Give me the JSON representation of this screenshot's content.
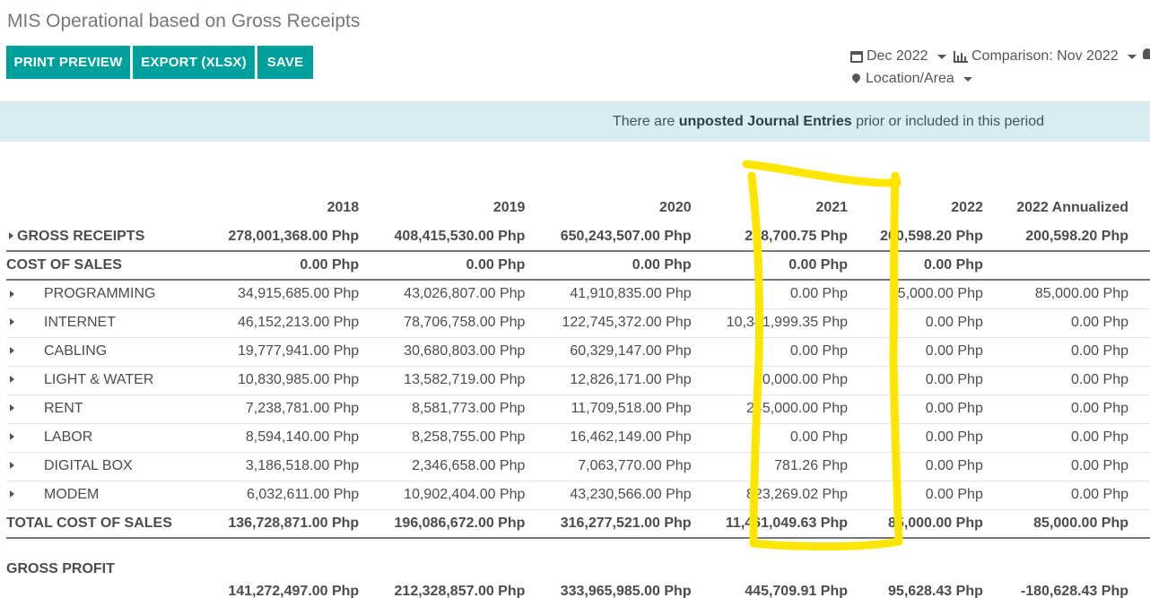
{
  "page": {
    "title": "MIS Operational based on Gross Receipts"
  },
  "toolbar": {
    "print_label": "PRINT PREVIEW",
    "export_label": "EXPORT (XLSX)",
    "save_label": "SAVE"
  },
  "filters": {
    "date": "Dec 2022",
    "comparison": "Comparison: Nov 2022",
    "location": "Location/Area"
  },
  "notice": {
    "prefix": "There are ",
    "bold": "unposted Journal Entries",
    "suffix": " prior or included in this period"
  },
  "table": {
    "columns": [
      "2018",
      "2019",
      "2020",
      "2021",
      "2022",
      "2022 Annualized"
    ],
    "gross_receipts": {
      "label": "GROSS RECEIPTS",
      "values": [
        "278,001,368.00 Php",
        "408,415,530.00 Php",
        "650,243,507.00 Php",
        "298,700.75 Php",
        "200,598.20 Php",
        "200,598.20 Php"
      ]
    },
    "cost_of_sales": {
      "label": "COST OF SALES",
      "values": [
        "0.00 Php",
        "0.00 Php",
        "0.00 Php",
        "0.00 Php",
        "0.00 Php",
        ""
      ]
    },
    "items": [
      {
        "label": "PROGRAMMING",
        "values": [
          "34,915,685.00 Php",
          "43,026,807.00 Php",
          "41,910,835.00 Php",
          "0.00 Php",
          "85,000.00 Php",
          "85,000.00 Php"
        ]
      },
      {
        "label": "INTERNET",
        "values": [
          "46,152,213.00 Php",
          "78,706,758.00 Php",
          "122,745,372.00 Php",
          "10,341,999.35 Php",
          "0.00 Php",
          "0.00 Php"
        ]
      },
      {
        "label": "CABLING",
        "values": [
          "19,777,941.00 Php",
          "30,680,803.00 Php",
          "60,329,147.00 Php",
          "0.00 Php",
          "0.00 Php",
          "0.00 Php"
        ]
      },
      {
        "label": "LIGHT & WATER",
        "values": [
          "10,830,985.00 Php",
          "13,582,719.00 Php",
          "12,826,171.00 Php",
          "50,000.00 Php",
          "0.00 Php",
          "0.00 Php"
        ]
      },
      {
        "label": "RENT",
        "values": [
          "7,238,781.00 Php",
          "8,581,773.00 Php",
          "11,709,518.00 Php",
          "245,000.00 Php",
          "0.00 Php",
          "0.00 Php"
        ]
      },
      {
        "label": "LABOR",
        "values": [
          "8,594,140.00 Php",
          "8,258,755.00 Php",
          "16,462,149.00 Php",
          "0.00 Php",
          "0.00 Php",
          "0.00 Php"
        ]
      },
      {
        "label": "DIGITAL BOX",
        "values": [
          "3,186,518.00 Php",
          "2,346,658.00 Php",
          "7,063,770.00 Php",
          "781.26 Php",
          "0.00 Php",
          "0.00 Php"
        ]
      },
      {
        "label": "MODEM",
        "values": [
          "6,032,611.00 Php",
          "10,902,404.00 Php",
          "43,230,566.00 Php",
          "823,269.02 Php",
          "0.00 Php",
          "0.00 Php"
        ]
      }
    ],
    "total_cost_of_sales": {
      "label": "TOTAL COST OF SALES",
      "values": [
        "136,728,871.00 Php",
        "196,086,672.00 Php",
        "316,277,521.00 Php",
        "11,461,049.63 Php",
        "85,000.00 Php",
        "85,000.00 Php"
      ]
    },
    "gross_profit": {
      "label": "GROSS PROFIT",
      "values": [
        "141,272,497.00 Php",
        "212,328,857.00 Php",
        "333,965,985.00 Php",
        "445,709.91 Php",
        "95,628.43 Php",
        "-180,628.43 Php"
      ]
    }
  },
  "annotation": {
    "color": "#ffe600"
  }
}
